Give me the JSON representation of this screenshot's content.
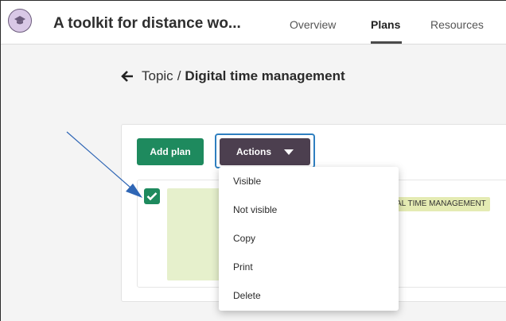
{
  "app": {
    "title": "A toolkit for distance wo...",
    "logo_icon": "graduation-cap-icon"
  },
  "nav": {
    "tabs": [
      {
        "label": "Overview",
        "active": false
      },
      {
        "label": "Plans",
        "active": true
      },
      {
        "label": "Resources",
        "active": false
      }
    ]
  },
  "breadcrumb": {
    "parent": "Topic",
    "separator": "/",
    "current": "Digital time management"
  },
  "toolbar": {
    "add_plan_label": "Add plan",
    "actions_label": "Actions"
  },
  "actions_menu": {
    "items": [
      "Visible",
      "Not visible",
      "Copy",
      "Print",
      "Delete"
    ]
  },
  "plan_row": {
    "checked": true,
    "tag": "AL TIME MANAGEMENT"
  },
  "colors": {
    "add_button": "#1e8a5e",
    "actions_button": "#4c3f4f",
    "focus_ring": "#2f7fc0",
    "tag_bg": "#e4ebb3",
    "thumb_bg": "#e6f0cc",
    "annotation_arrow": "#2f66b5"
  }
}
